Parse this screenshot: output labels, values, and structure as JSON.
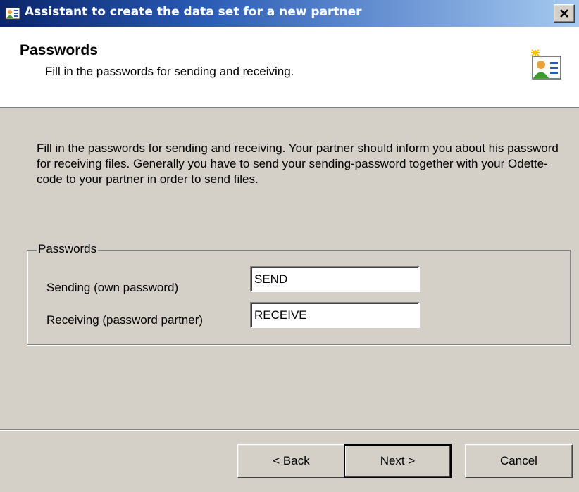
{
  "window": {
    "title": "Assistant to create the data set for a new partner",
    "icon": "wizard-icon",
    "close_icon": "close-icon"
  },
  "header": {
    "title": "Passwords",
    "subtitle": "Fill in the passwords for sending and receiving.",
    "icon": "partner-card-icon"
  },
  "description": "Fill in the passwords for sending and receiving. Your partner should inform you about his password for receiving files. Generally you have to send your sending-password together with your Odette-code to your partner in order to send files.",
  "passwords_group": {
    "legend": "Passwords",
    "sending_label": "Sending (own password)",
    "sending_value": "SEND",
    "receiving_label": "Receiving (password partner)",
    "receiving_value": "RECEIVE"
  },
  "buttons": {
    "back": "< Back",
    "next": "Next >",
    "cancel": "Cancel"
  },
  "colors": {
    "face": "#d4d0c8",
    "title_gradient_start": "#0a246a",
    "title_gradient_end": "#a6caf0",
    "header_bg": "#ffffff"
  }
}
